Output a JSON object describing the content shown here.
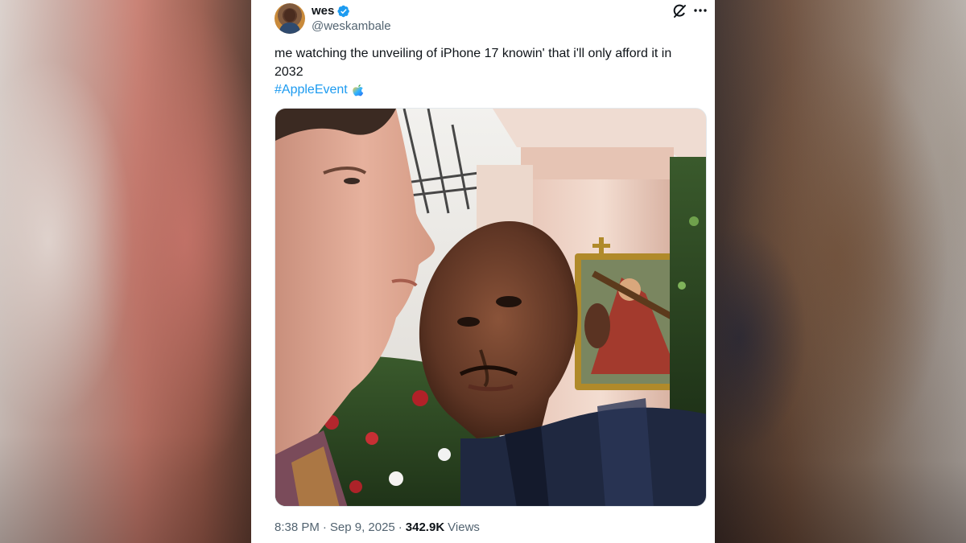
{
  "tweet": {
    "author": {
      "display_name": "wes",
      "handle": "@weskambale",
      "verified": true
    },
    "text": "me watching the unveiling of iPhone 17 knowin' that i'll only afford it in 2032",
    "hashtag": "#AppleEvent",
    "hashtag_emoji": "apple-event-emoji-icon",
    "time": "8:38 PM",
    "separator": "·",
    "date": "Sep 9, 2025",
    "views_count": "342.9K",
    "views_label": "Views"
  },
  "icons": {
    "verified": "verified-badge-icon",
    "grok": "grok-icon",
    "more": "more-options-icon"
  },
  "colors": {
    "accent": "#1d9bf0",
    "text_primary": "#0f1419",
    "text_secondary": "#536471"
  }
}
